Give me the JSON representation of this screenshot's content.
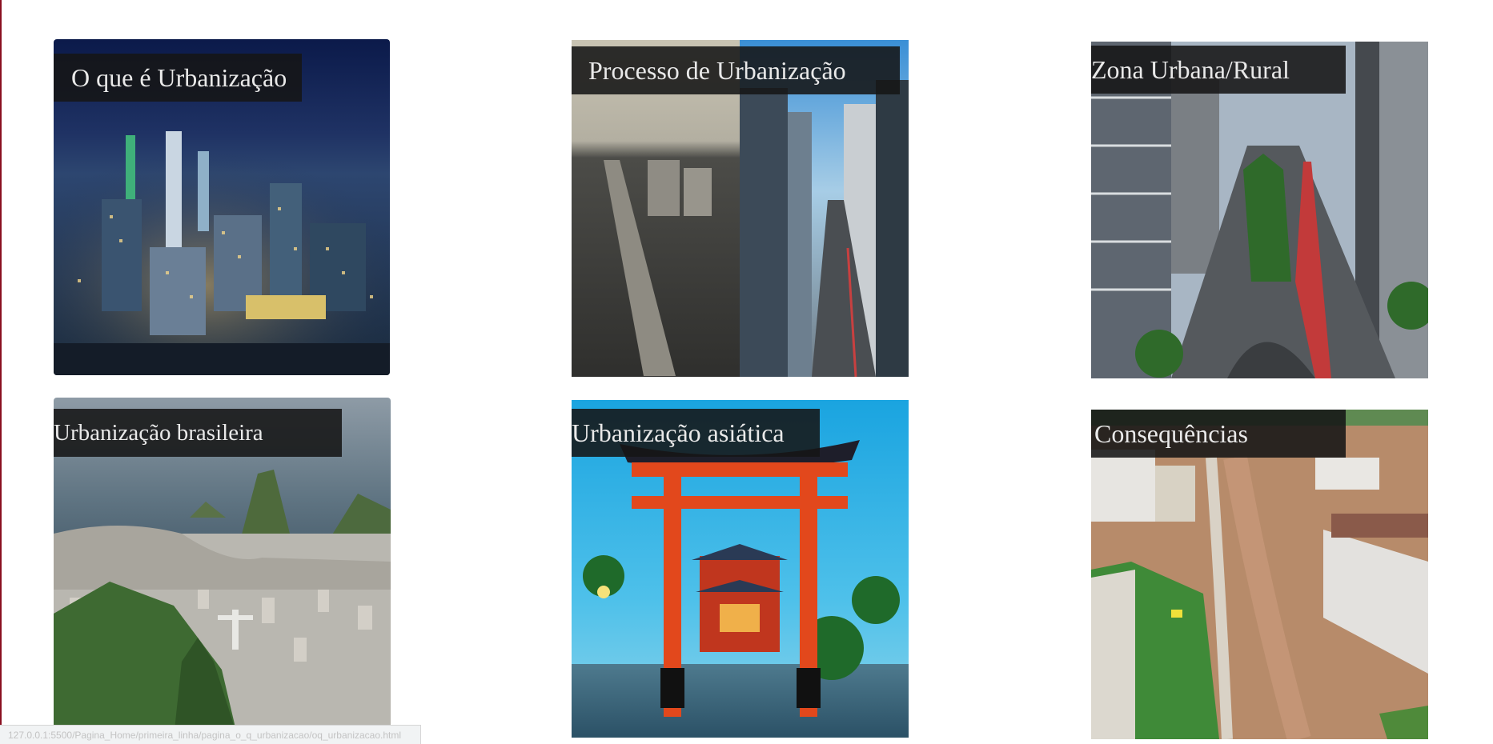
{
  "cards": [
    {
      "title": "O que é Urbanização"
    },
    {
      "title": "Processo de Urbanização"
    },
    {
      "title": "Zona Urbana/Rural"
    },
    {
      "title": "Urbanização brasileira"
    },
    {
      "title": "Urbanização asiática"
    },
    {
      "title": "Consequências"
    }
  ],
  "status_bar": {
    "url": "127.0.0.1:5500/Pagina_Home/primeira_linha/pagina_o_q_urbanizacao/oq_urbanizacao.html"
  },
  "colors": {
    "caption_bg": "#161616",
    "caption_text": "#e9e9e9",
    "page_bg": "#ffffff",
    "edge": "#8a1020"
  }
}
